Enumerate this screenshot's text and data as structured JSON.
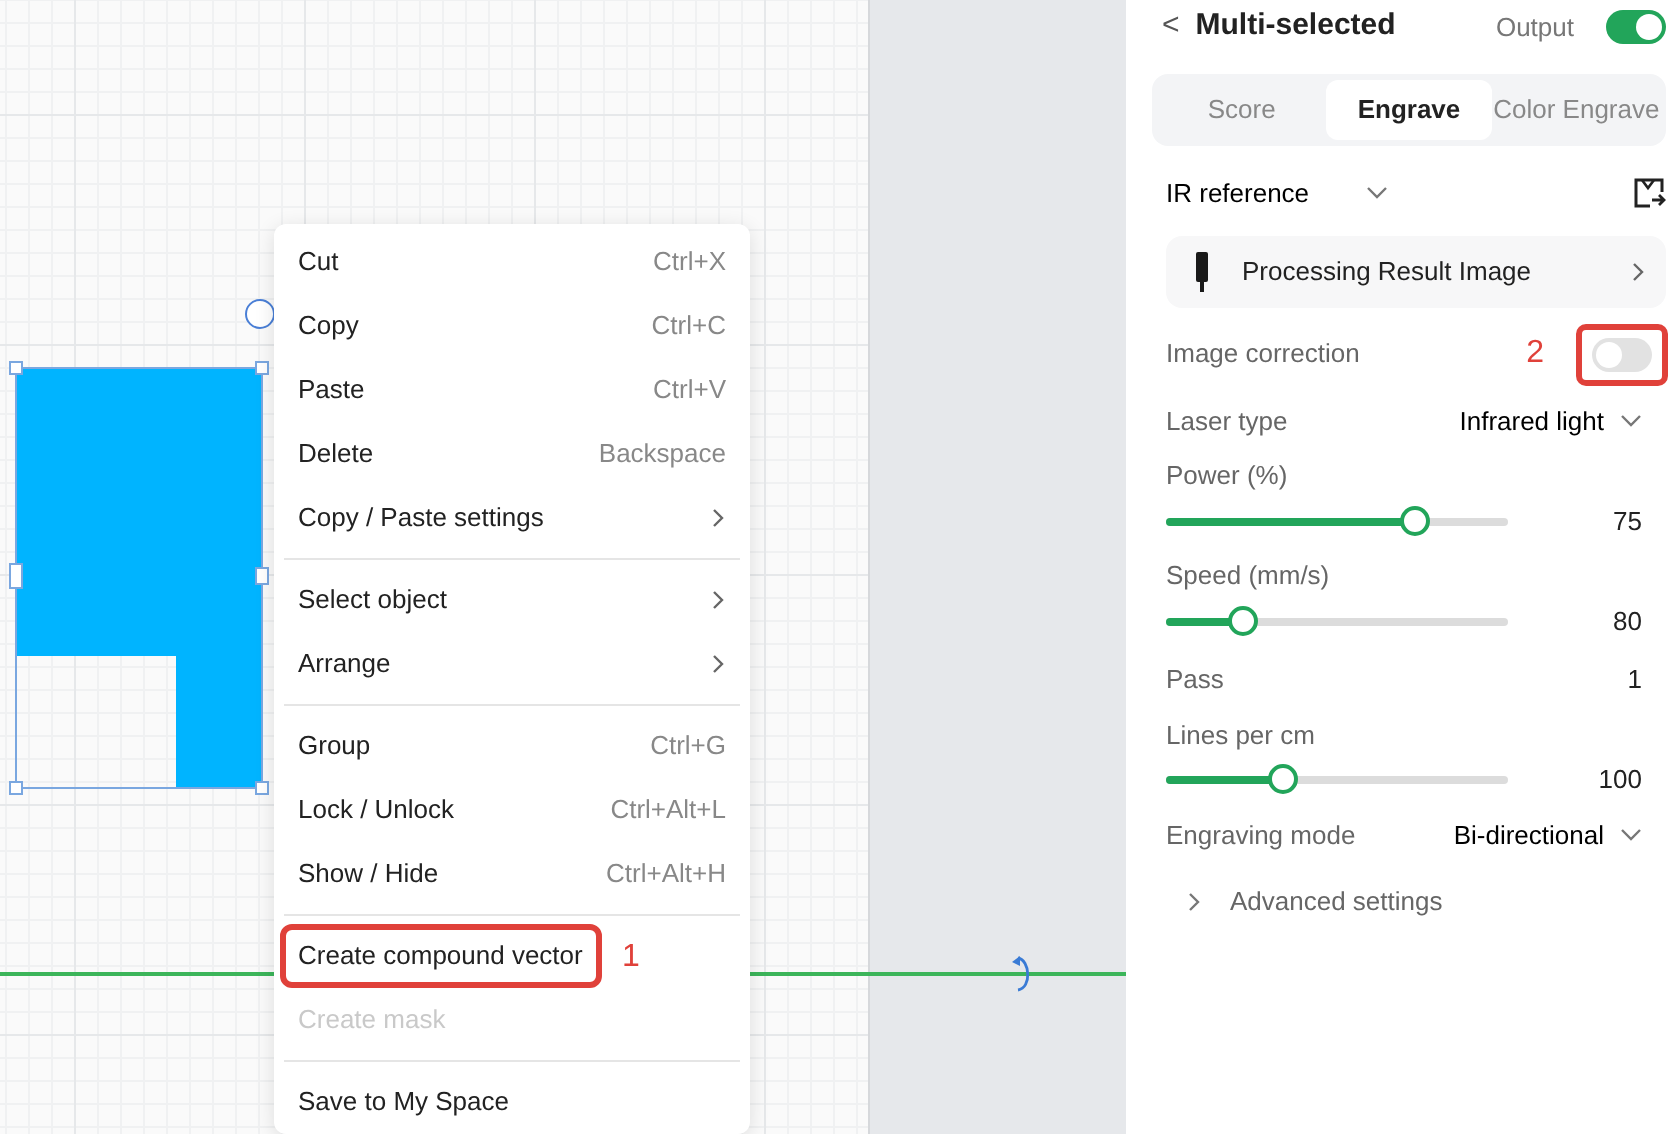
{
  "context_menu": {
    "groups": [
      [
        {
          "label": "Cut",
          "shortcut": "Ctrl+X",
          "submenu": false,
          "disabled": false
        },
        {
          "label": "Copy",
          "shortcut": "Ctrl+C",
          "submenu": false,
          "disabled": false
        },
        {
          "label": "Paste",
          "shortcut": "Ctrl+V",
          "submenu": false,
          "disabled": false
        },
        {
          "label": "Delete",
          "shortcut": "Backspace",
          "submenu": false,
          "disabled": false
        },
        {
          "label": "Copy / Paste settings",
          "submenu": true,
          "disabled": false
        }
      ],
      [
        {
          "label": "Select object",
          "submenu": true,
          "disabled": false
        },
        {
          "label": "Arrange",
          "submenu": true,
          "disabled": false
        }
      ],
      [
        {
          "label": "Group",
          "shortcut": "Ctrl+G",
          "submenu": false,
          "disabled": false
        },
        {
          "label": "Lock / Unlock",
          "shortcut": "Ctrl+Alt+L",
          "submenu": false,
          "disabled": false
        },
        {
          "label": "Show / Hide",
          "shortcut": "Ctrl+Alt+H",
          "submenu": false,
          "disabled": false
        }
      ],
      [
        {
          "label": "Create compound vector",
          "submenu": false,
          "disabled": false,
          "annotation": "1"
        },
        {
          "label": "Create mask",
          "submenu": false,
          "disabled": true
        }
      ],
      [
        {
          "label": "Save to My Space",
          "submenu": false,
          "disabled": false
        }
      ]
    ]
  },
  "panel": {
    "back": "<",
    "title": "Multi-selected",
    "output_label": "Output",
    "output_on": true,
    "tabs": [
      {
        "label": "Score",
        "selected": false
      },
      {
        "label": "Engrave",
        "selected": true
      },
      {
        "label": "Color Engrave",
        "selected": false
      }
    ],
    "reference": {
      "label": "IR reference"
    },
    "result_card": {
      "label": "Processing Result Image"
    },
    "settings": [
      {
        "kind": "toggle",
        "label": "Image correction",
        "on": false,
        "annotation": "2"
      },
      {
        "kind": "select",
        "label": "Laser type",
        "value": "Infrared light"
      },
      {
        "kind": "slider",
        "label": "Power (%)",
        "level": 0.75,
        "value": "75"
      },
      {
        "kind": "slider",
        "label": "Speed (mm/s)",
        "level": 0.2,
        "value": "80"
      },
      {
        "kind": "value",
        "label": "Pass",
        "value": "1"
      },
      {
        "kind": "slider",
        "label": "Lines per cm",
        "level": 0.33,
        "value": "100"
      },
      {
        "kind": "select",
        "label": "Engraving mode",
        "value": "Bi-directional"
      },
      {
        "kind": "expander",
        "label": "Advanced settings",
        "expanded": false
      }
    ]
  }
}
